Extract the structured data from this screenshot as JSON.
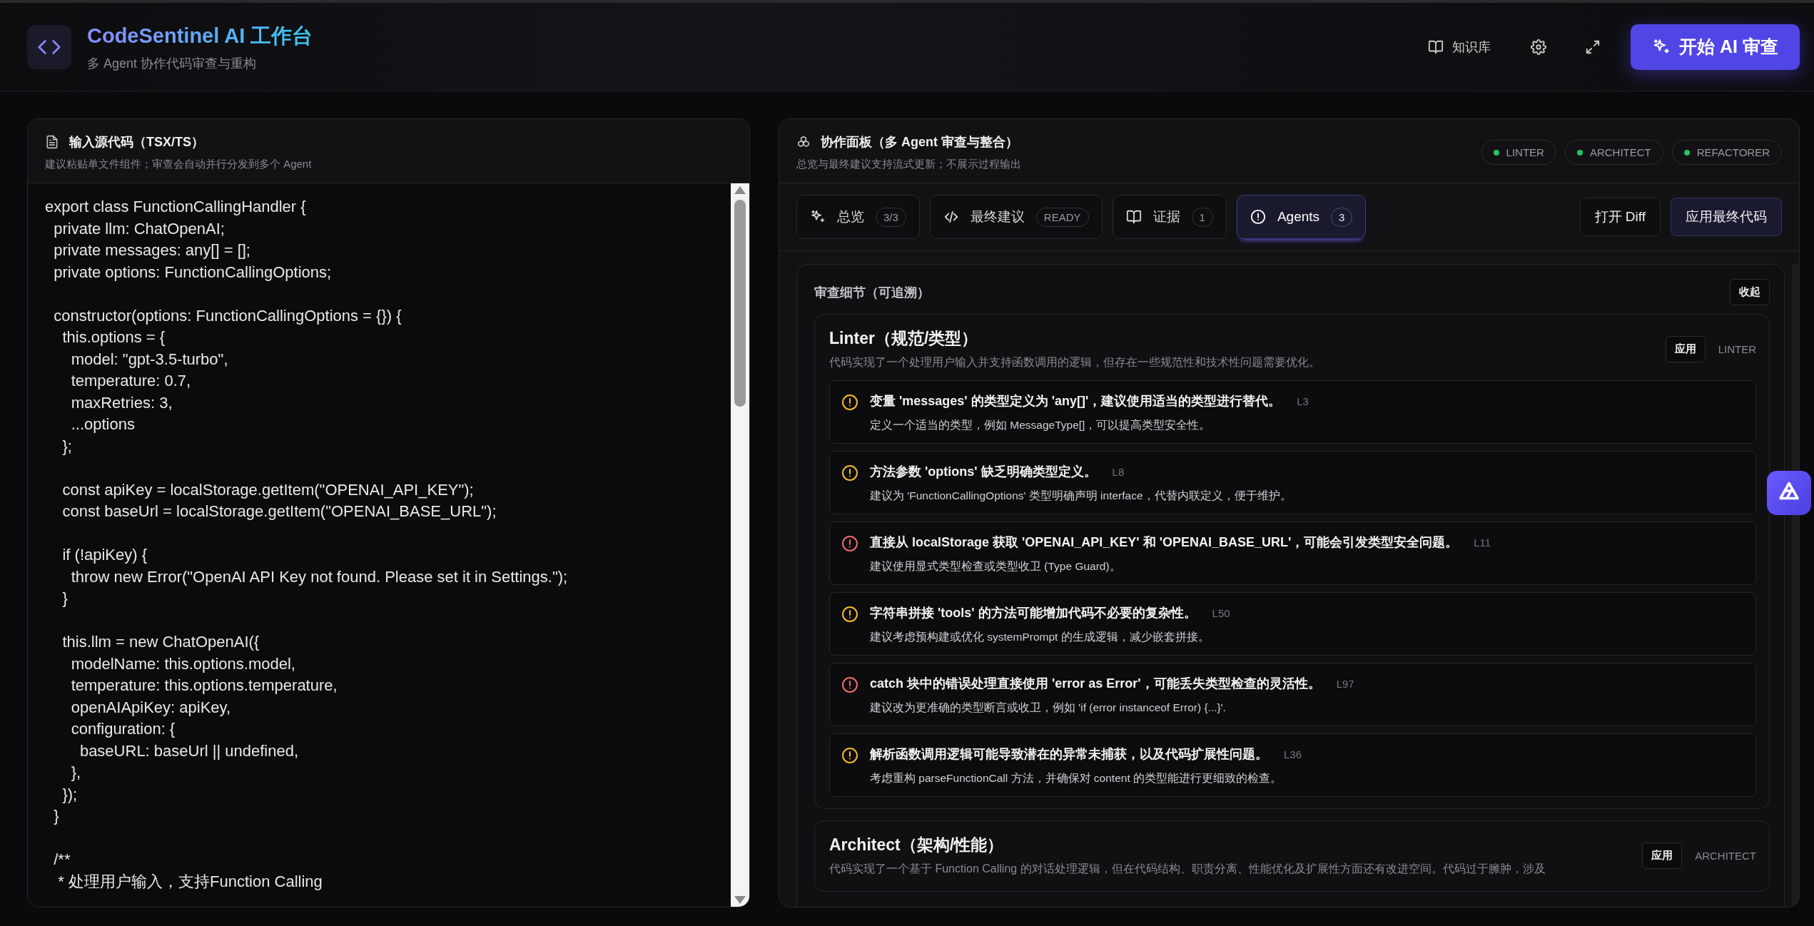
{
  "header": {
    "title": "CodeSentinel AI 工作台",
    "subtitle": "多 Agent 协作代码审查与重构",
    "nav": [
      {
        "kind": "book",
        "label": "知识库"
      },
      {
        "kind": "gear"
      },
      {
        "kind": "expand"
      }
    ],
    "primary_button": "开始 AI 审查"
  },
  "source_panel": {
    "title": "输入源代码（TSX/TS）",
    "subtitle": "建议粘贴单文件组件；审查会自动并行分发到多个 Agent",
    "code_blocks": [
      [
        "export class FunctionCallingHandler {",
        "  private llm: ChatOpenAI;",
        "  private messages: any[] = [];",
        "  private options: FunctionCallingOptions;"
      ],
      [
        "  constructor(options: FunctionCallingOptions = {}) {",
        "    this.options = {",
        "      model: \"gpt-3.5-turbo\",",
        "      temperature: 0.7,",
        "      maxRetries: 3,",
        "      ...options",
        "    };"
      ],
      [
        "    const apiKey = localStorage.getItem(\"OPENAI_API_KEY\");",
        "    const baseUrl = localStorage.getItem(\"OPENAI_BASE_URL\");"
      ],
      [
        "    if (!apiKey) {",
        "      throw new Error(\"OpenAI API Key not found. Please set it in Settings.\");",
        "    }"
      ],
      [
        "    this.llm = new ChatOpenAI({",
        "      modelName: this.options.model,",
        "      temperature: this.options.temperature,",
        "      openAIApiKey: apiKey,",
        "      configuration: {",
        "        baseURL: baseUrl || undefined,",
        "      },",
        "    });",
        "  }"
      ],
      [
        "  /**",
        "   * 处理用户输入，支持Function Calling"
      ]
    ]
  },
  "collab_panel": {
    "title": "协作面板（多 Agent 审查与整合）",
    "subtitle": "总览与最终建议支持流式更新；不展示过程输出",
    "agents": [
      {
        "label": "LINTER",
        "color": "#22c55e"
      },
      {
        "label": "ARCHITECT",
        "color": "#22c55e"
      },
      {
        "label": "REFACTORER",
        "color": "#22c55e"
      }
    ],
    "tabs": [
      {
        "kind": "sparkle",
        "label": "总览",
        "badge": "3/3",
        "selected": false
      },
      {
        "kind": "code",
        "label": "最终建议",
        "badge": "READY",
        "selected": false
      },
      {
        "kind": "book",
        "label": "证据",
        "badge": "1",
        "selected": false
      },
      {
        "kind": "alert",
        "label": "Agents",
        "badge": "3",
        "selected": true
      }
    ],
    "actions": [
      "打开 Diff",
      "应用最终代码"
    ],
    "details": {
      "title": "审查细节（可追溯）",
      "collapse_button": "收起",
      "agent_cards": [
        {
          "title": "Linter（规范/类型）",
          "summary": "代码实现了一个处理用户输入并支持函数调用的逻辑，但存在一些规范性和技术性问题需要优化。",
          "apply_button": "应用",
          "tag": "LINTER",
          "issues": [
            {
              "kind": "warning",
              "title": "变量 'messages' 的类型定义为 'any[]'，建议使用适当的类型进行替代。",
              "line": "L3",
              "suggestion": "定义一个适当的类型，例如 MessageType[]，可以提高类型安全性。"
            },
            {
              "kind": "warning",
              "title": "方法参数 'options' 缺乏明确类型定义。",
              "line": "L8",
              "suggestion": "建议为 'FunctionCallingOptions' 类型明确声明 interface，代替内联定义，便于维护。"
            },
            {
              "kind": "error",
              "title": "直接从 localStorage 获取 'OPENAI_API_KEY' 和 'OPENAI_BASE_URL'，可能会引发类型安全问题。",
              "line": "L11",
              "suggestion": "建议使用显式类型检查或类型收卫 (Type Guard)。"
            },
            {
              "kind": "warning",
              "title": "字符串拼接 'tools' 的方法可能增加代码不必要的复杂性。",
              "line": "L50",
              "suggestion": "建议考虑预构建或优化 systemPrompt 的生成逻辑，减少嵌套拼接。"
            },
            {
              "kind": "error",
              "title": "catch 块中的错误处理直接使用 'error as Error'，可能丢失类型检查的灵活性。",
              "line": "L97",
              "suggestion": "建议改为更准确的类型断言或收卫，例如 'if (error instanceof Error) {...}'."
            },
            {
              "kind": "warning",
              "title": "解析函数调用逻辑可能导致潜在的异常未捕获，以及代码扩展性问题。",
              "line": "L36",
              "suggestion": "考虑重构 parseFunctionCall 方法，并确保对 content 的类型能进行更细致的检查。"
            }
          ]
        },
        {
          "title": "Architect（架构/性能）",
          "summary": "代码实现了一个基于 Function Calling 的对话处理逻辑，但在代码结构、职责分离、性能优化及扩展性方面还有改进空间。代码过于臃肿，涉及",
          "apply_button": "应用",
          "tag": "ARCHITECT"
        }
      ]
    }
  }
}
